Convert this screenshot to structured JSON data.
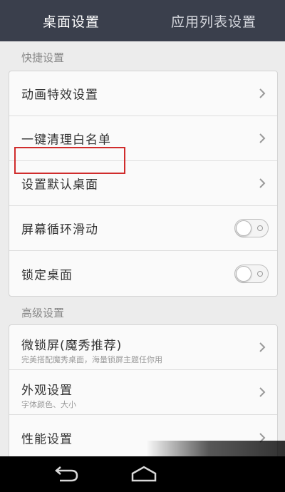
{
  "tabs": {
    "active": "桌面设置",
    "inactive": "应用列表设置"
  },
  "sections": {
    "quick": {
      "title": "快捷设置",
      "rows": [
        {
          "label": "动画特效设置",
          "control": "chevron"
        },
        {
          "label": "一键清理白名单",
          "control": "chevron"
        },
        {
          "label": "设置默认桌面",
          "control": "chevron"
        },
        {
          "label": "屏幕循环滑动",
          "control": "toggle",
          "on": false
        },
        {
          "label": "锁定桌面",
          "control": "toggle",
          "on": false
        }
      ]
    },
    "advanced": {
      "title": "高级设置",
      "rows": [
        {
          "label": "微锁屏(魔秀推荐)",
          "sub": "完美搭配魔秀桌面，海量锁屏主题任你用",
          "control": "chevron"
        },
        {
          "label": "外观设置",
          "sub": "字体颜色、大小",
          "control": "chevron"
        },
        {
          "label": "性能设置",
          "control": "chevron"
        }
      ]
    }
  },
  "icons": {
    "chevron": "chevron-right-icon",
    "back": "back-arrow-icon",
    "home": "home-icon"
  },
  "colors": {
    "header_bg": "#3a3f4c",
    "highlight": "#d02c2c"
  }
}
